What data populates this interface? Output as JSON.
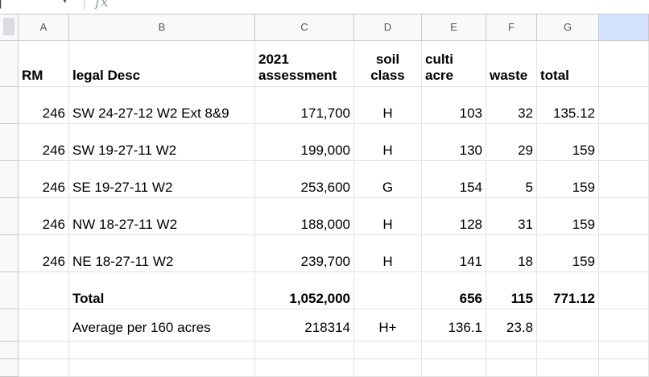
{
  "formula_bar": {
    "fx_label": "fx",
    "chevron": "▾"
  },
  "columns": [
    "A",
    "B",
    "C",
    "D",
    "E",
    "F",
    "G"
  ],
  "header_row": {
    "rm": "RM",
    "legal": "legal Desc",
    "assessment": "2021 assessment",
    "soil": "soil class",
    "culti": "culti acre",
    "waste": "waste",
    "total": "total"
  },
  "rows": [
    {
      "rm": "246",
      "legal": "SW 24-27-12 W2 Ext 8&9",
      "assessment": "171,700",
      "soil": "H",
      "culti": "103",
      "waste": "32",
      "total": "135.12"
    },
    {
      "rm": "246",
      "legal": "SW 19-27-11 W2",
      "assessment": "199,000",
      "soil": "H",
      "culti": "130",
      "waste": "29",
      "total": "159"
    },
    {
      "rm": "246",
      "legal": "SE 19-27-11 W2",
      "assessment": "253,600",
      "soil": "G",
      "culti": "154",
      "waste": "5",
      "total": "159"
    },
    {
      "rm": "246",
      "legal": "NW 18-27-11 W2",
      "assessment": "188,000",
      "soil": "H",
      "culti": "128",
      "waste": "31",
      "total": "159"
    },
    {
      "rm": "246",
      "legal": "NE 18-27-11 W2",
      "assessment": "239,700",
      "soil": "H",
      "culti": "141",
      "waste": "18",
      "total": "159"
    }
  ],
  "total_row": {
    "label": "Total",
    "assessment": "1,052,000",
    "culti": "656",
    "waste": "115",
    "total": "771.12"
  },
  "average_row": {
    "label": "Average per 160 acres",
    "assessment": "218314",
    "soil": "H+",
    "culti": "136.1",
    "waste": "23.8"
  }
}
